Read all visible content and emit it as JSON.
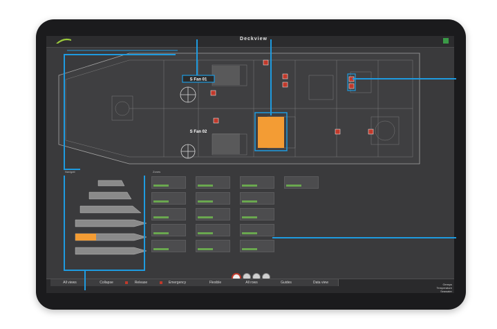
{
  "app": {
    "title": "Deckview",
    "subtitle": "",
    "status_lines": [
      "",
      ""
    ],
    "status_color": "#3a9a47"
  },
  "plan": {
    "fan_1": "S Fan 01",
    "fan_2": "S Fan 02",
    "nav_label": "Navigati",
    "zones_label": "Zones"
  },
  "zones": [
    {
      "name": "",
      "value": "",
      "pct": ""
    }
  ],
  "tabs": [
    {
      "label": "All views"
    },
    {
      "label": "Collapse"
    },
    {
      "label": "Release"
    },
    {
      "label": "Emergency"
    },
    {
      "label": "Flexible"
    },
    {
      "label": "All rows"
    },
    {
      "label": "Guides"
    },
    {
      "label": "Data view"
    }
  ],
  "footer": {
    "name": "Gensys",
    "line1": "Temperature",
    "line2": "Seawater"
  },
  "colors": {
    "accent": "#1e9be0",
    "alarm": "#c0392b",
    "highlight": "#f39c34",
    "ok": "#6aa84f"
  }
}
